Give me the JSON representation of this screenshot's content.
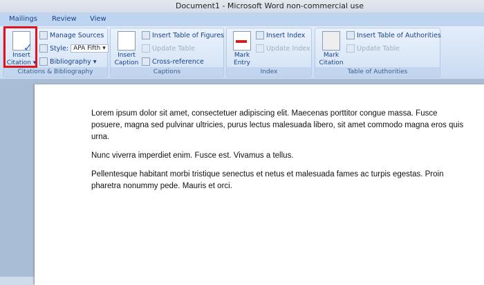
{
  "window": {
    "title": "Document1 - Microsoft Word non-commercial use"
  },
  "tabs": [
    "Mailings",
    "Review",
    "View"
  ],
  "ribbon": {
    "citations": {
      "label": "Citations & Bibliography",
      "insert_citation": [
        "Insert",
        "Citation"
      ],
      "manage_sources": "Manage Sources",
      "style_label": "Style:",
      "style_value": "APA Fifth",
      "bibliography": "Bibliography"
    },
    "captions": {
      "label": "Captions",
      "insert_caption": [
        "Insert",
        "Caption"
      ],
      "insert_table_of_figures": "Insert Table of Figures",
      "update_table": "Update Table",
      "cross_reference": "Cross-reference"
    },
    "index": {
      "label": "Index",
      "mark_entry": [
        "Mark",
        "Entry"
      ],
      "insert_index": "Insert Index",
      "update_index": "Update Index"
    },
    "toa": {
      "label": "Table of Authorities",
      "mark_citation": [
        "Mark",
        "Citation"
      ],
      "insert_toa": "Insert Table of Authorities",
      "update_table": "Update Table"
    }
  },
  "document": {
    "paragraphs": [
      "Lorem ipsum dolor sit amet, consectetuer adipiscing elit. Maecenas porttitor congue massa. Fusce posuere, magna sed pulvinar ultricies, purus lectus malesuada libero, sit amet commodo magna eros quis urna.",
      "Nunc viverra imperdiet enim. Fusce est. Vivamus a tellus.",
      "Pellentesque habitant morbi tristique senectus et netus et malesuada fames ac turpis egestas. Proin pharetra nonummy pede. Mauris et orci."
    ]
  }
}
